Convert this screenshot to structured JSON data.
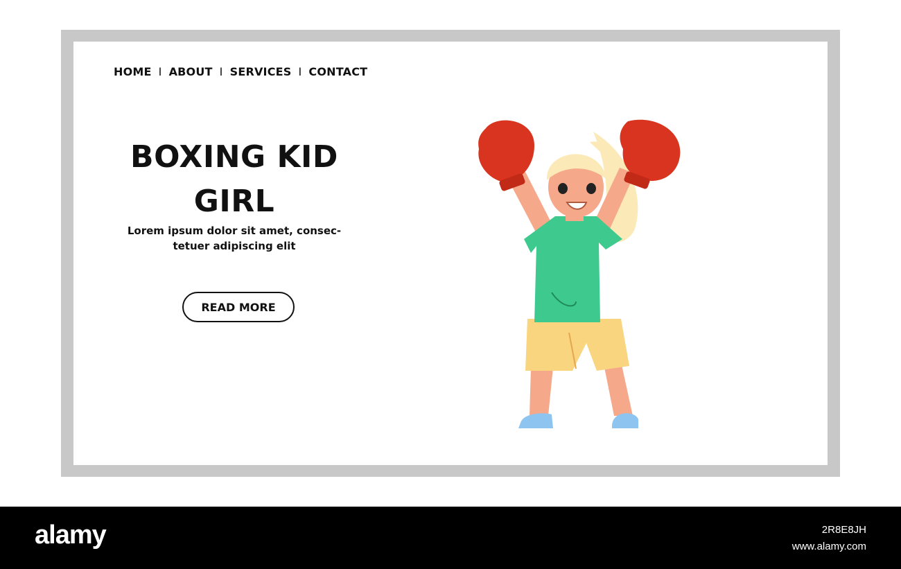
{
  "nav": {
    "items": [
      "HOME",
      "ABOUT",
      "SERVICES",
      "CONTACT"
    ],
    "separator": "I"
  },
  "hero": {
    "title_line1": "BOXING KID",
    "title_line2": "GIRL",
    "desc_line1": "Lorem ipsum dolor sit amet, consec-",
    "desc_line2": "tetuer adipiscing elit",
    "button": "READ MORE"
  },
  "illustration": {
    "icon": "boxing-girl-illustration",
    "colors": {
      "glove": "#d9341f",
      "shirt": "#3ec98e",
      "shorts": "#f8d57e",
      "skin": "#f5a98a",
      "hair": "#fbeab8",
      "shoe": "#8ec4f0"
    }
  },
  "footer": {
    "brand": "alamy",
    "image_id": "2R8E8JH",
    "url": "www.alamy.com"
  },
  "colors": {
    "frame": "#c8c8c8",
    "text": "#111111",
    "footer_bg": "#000000"
  }
}
